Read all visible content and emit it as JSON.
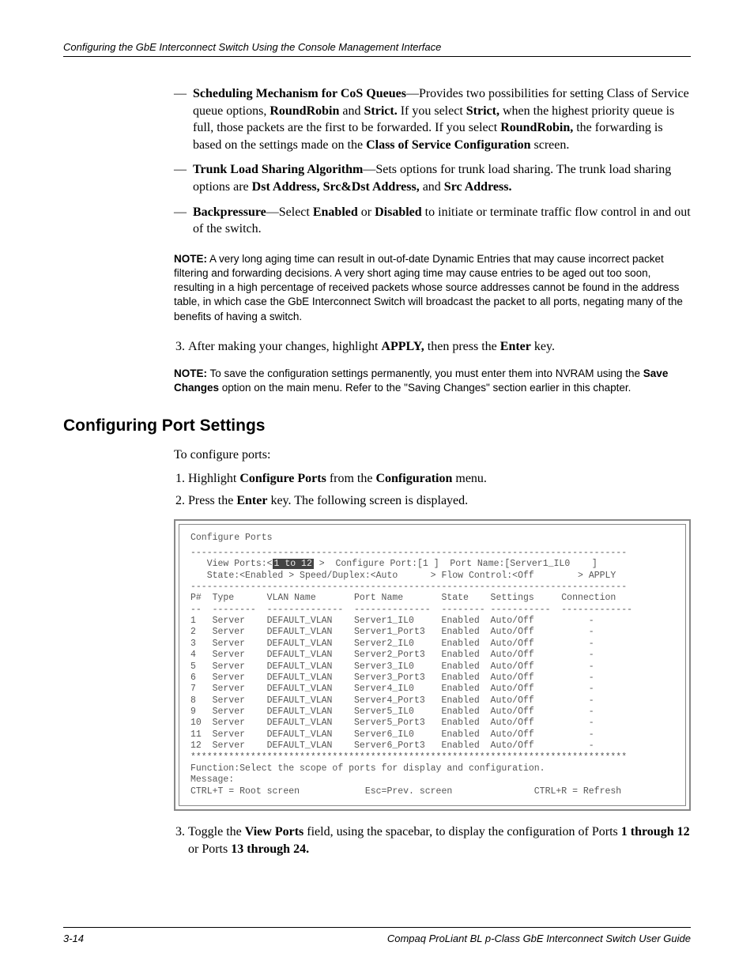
{
  "running_head": "Configuring the GbE Interconnect Switch Using the Console Management Interface",
  "bullets": {
    "b1_pre": "Scheduling Mechanism for CoS Queues",
    "b1_post": "—Provides two possibilities for setting Class of Service queue options, ",
    "b1_rr": "RoundRobin",
    "b1_and": " and ",
    "b1_strict": "Strict.",
    "b1_ifsel": " If you select ",
    "b1_strict2": "Strict,",
    "b1_when": " when the highest priority queue is full, those packets are the first to be forwarded. If you select ",
    "b1_rr2": "RoundRobin,",
    "b1_fwd": " the forwarding is based on the settings made on the ",
    "b1_cos": "Class of Service Configuration",
    "b1_scr": " screen.",
    "b2_pre": "Trunk Load Sharing Algorithm",
    "b2_post": "—Sets options for trunk load sharing. The trunk load sharing options are ",
    "b2_o1": "Dst Address, Src&Dst Address,",
    "b2_and": " and ",
    "b2_o2": "Src Address.",
    "b3_pre": "Backpressure",
    "b3_sel": "—Select ",
    "b3_en": "Enabled",
    "b3_or": " or ",
    "b3_dis": "Disabled",
    "b3_rest": " to initiate or terminate traffic flow control in and out of the switch."
  },
  "note1_label": "NOTE:",
  "note1_text": "  A very long aging time can result in out-of-date Dynamic Entries that may cause incorrect packet filtering and forwarding decisions. A very short aging time may cause entries to be aged out too soon, resulting in a high percentage of received packets whose source addresses cannot be found in the address table, in which case the GbE Interconnect Switch will broadcast the packet to all ports, negating many of the benefits of having a switch.",
  "step3_a": "After making your changes, highlight ",
  "step3_apply": "APPLY,",
  "step3_b": " then press the ",
  "step3_enter": "Enter",
  "step3_c": " key.",
  "note2_label": "NOTE:",
  "note2_text_a": "  To save the configuration settings permanently, you must enter them into NVRAM using the ",
  "note2_bold": "Save Changes",
  "note2_text_b": " option on the main menu. Refer to the \"Saving Changes\" section earlier in this chapter.",
  "heading": "Configuring Port Settings",
  "intro": "To configure ports:",
  "ol1_a": "Highlight ",
  "ol1_b": "Configure Ports",
  "ol1_c": " from the ",
  "ol1_d": "Configuration",
  "ol1_e": " menu.",
  "ol2_a": "Press the ",
  "ol2_b": "Enter",
  "ol2_c": " key. The following screen is displayed.",
  "terminal": {
    "title": "Configure Ports",
    "vp_label": "View Ports:",
    "vp_value": "1 to 12",
    "cp": "Configure Port:[1 ]  Port Name:[Server1_IL0    ]",
    "state_line_a": "State:<Enabled > Speed/Duplex:<Auto      > Flow Control:<Off        > ",
    "apply": "APPLY",
    "header": "P#  Type      VLAN Name       Port Name       State    Settings     Connection",
    "divider": "--  --------  --------------  --------------  -------- -----------  -------------",
    "rows": [
      "1   Server    DEFAULT_VLAN    Server1_IL0     Enabled  Auto/Off          -",
      "2   Server    DEFAULT_VLAN    Server1_Port3   Enabled  Auto/Off          -",
      "3   Server    DEFAULT_VLAN    Server2_IL0     Enabled  Auto/Off          -",
      "4   Server    DEFAULT_VLAN    Server2_Port3   Enabled  Auto/Off          -",
      "5   Server    DEFAULT_VLAN    Server3_IL0     Enabled  Auto/Off          -",
      "6   Server    DEFAULT_VLAN    Server3_Port3   Enabled  Auto/Off          -",
      "7   Server    DEFAULT_VLAN    Server4_IL0     Enabled  Auto/Off          -",
      "8   Server    DEFAULT_VLAN    Server4_Port3   Enabled  Auto/Off          -",
      "9   Server    DEFAULT_VLAN    Server5_IL0     Enabled  Auto/Off          -",
      "10  Server    DEFAULT_VLAN    Server5_Port3   Enabled  Auto/Off          -",
      "11  Server    DEFAULT_VLAN    Server6_IL0     Enabled  Auto/Off          -",
      "12  Server    DEFAULT_VLAN    Server6_Port3   Enabled  Auto/Off          -"
    ],
    "stars": "********************************************************************************",
    "func": "Function:Select the scope of ports for display and configuration.",
    "msg": "Message:",
    "foot": "CTRL+T = Root screen            Esc=Prev. screen               CTRL+R = Refresh"
  },
  "ol3_a": "Toggle the ",
  "ol3_b": "View Ports",
  "ol3_c": " field, using the spacebar, to display the configuration of Ports ",
  "ol3_d": "1 through 12",
  "ol3_e": " or Ports ",
  "ol3_f": "13 through 24.",
  "footer_left": "3-14",
  "footer_right": "Compaq ProLiant BL p-Class GbE Interconnect Switch User Guide"
}
